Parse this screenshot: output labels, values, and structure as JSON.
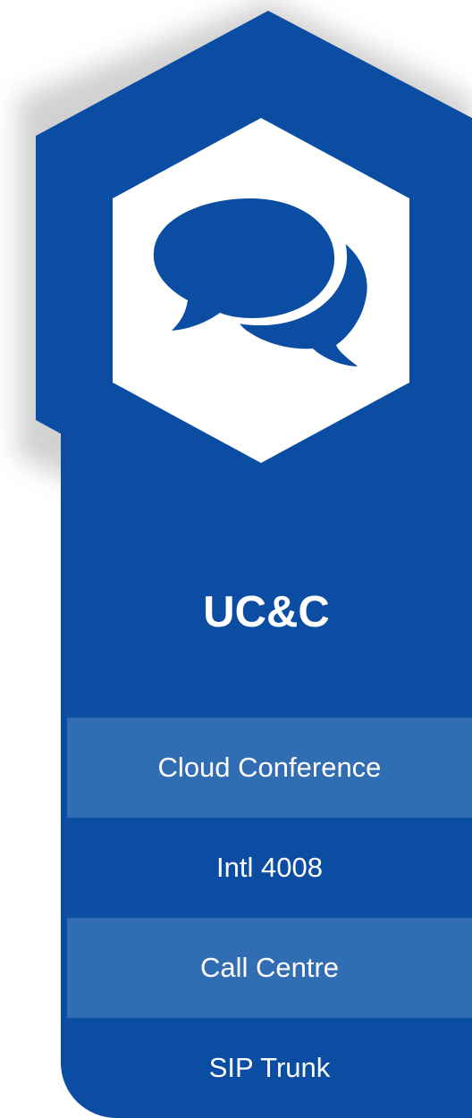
{
  "colors": {
    "brand_blue": "#0a4da2",
    "row_highlight": "#316db3",
    "text": "#ffffff",
    "icon_background": "#ffffff"
  },
  "card": {
    "icon": "chat-bubbles-icon",
    "title": "UC&C",
    "items": [
      {
        "label": "Cloud Conference",
        "shaded": true
      },
      {
        "label": "Intl 4008",
        "shaded": false
      },
      {
        "label": "Call Centre",
        "shaded": true
      },
      {
        "label": "SIP Trunk",
        "shaded": false
      }
    ]
  }
}
